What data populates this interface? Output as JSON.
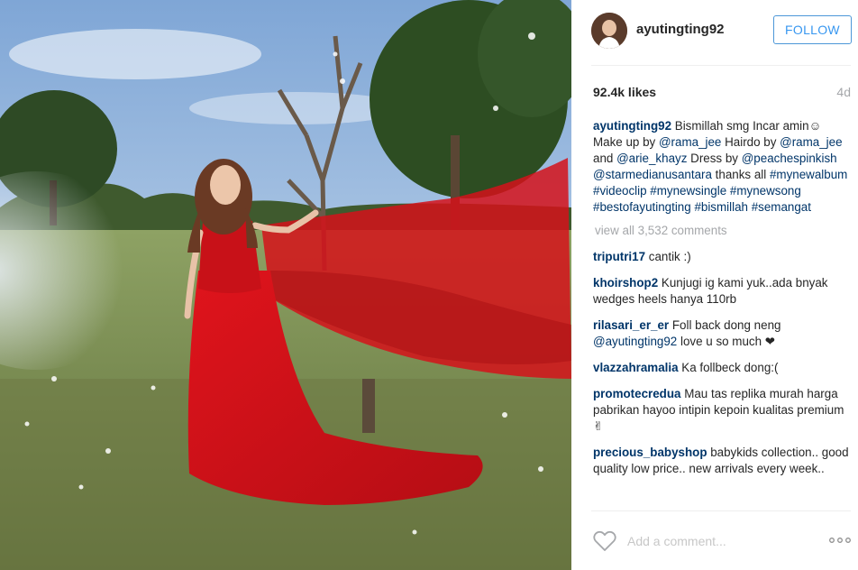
{
  "post": {
    "username": "ayutingting92",
    "follow_label": "FOLLOW",
    "likes": "92.4k likes",
    "time_ago": "4d",
    "view_all": "view all 3,532 comments",
    "add_comment_placeholder": "Add a comment...",
    "colors": {
      "link": "#003569",
      "follow": "#3897f0",
      "muted": "#a5a7aa"
    }
  },
  "caption": {
    "user": "ayutingting92",
    "t1": " Bismillah smg Incar amin☺ Make up by ",
    "m1": "@rama_jee",
    "t2": " Hairdo by ",
    "m2": "@rama_jee",
    "t3": " and ",
    "m3": "@arie_khayz",
    "t4": " Dress by ",
    "m4": "@peachespinkish",
    "t5": " ",
    "m5": "@starmedianusantara",
    "t6": " thanks all ",
    "tags": [
      "#mynewalbum",
      "#videoclip",
      "#mynewsingle",
      "#mynewsong",
      "#bestofayutingting",
      "#bismillah",
      "#semangat"
    ]
  },
  "comments": [
    {
      "user": "triputri17",
      "text": " cantik :)"
    },
    {
      "user": "khoirshop2",
      "text": " Kunjugi ig kami yuk..ada bnyak wedges heels hanya 110rb"
    },
    {
      "user": "rilasari_er_er",
      "text": " Foll back dong neng ",
      "mention": "@ayutingting92",
      "after": " love u so much ❤"
    },
    {
      "user": "vlazzahramalia",
      "text": " Ka follbeck dong:("
    },
    {
      "user": "promotecredua",
      "text": " Mau tas replika murah harga pabrikan hayoo intipin kepoin kualitas premium✌"
    },
    {
      "user": "precious_babyshop",
      "text": " babykids collection.. good quality low price.. new arrivals every week.."
    }
  ],
  "icons": {
    "heart": "heart-outline-icon",
    "more": "more-options-icon"
  }
}
